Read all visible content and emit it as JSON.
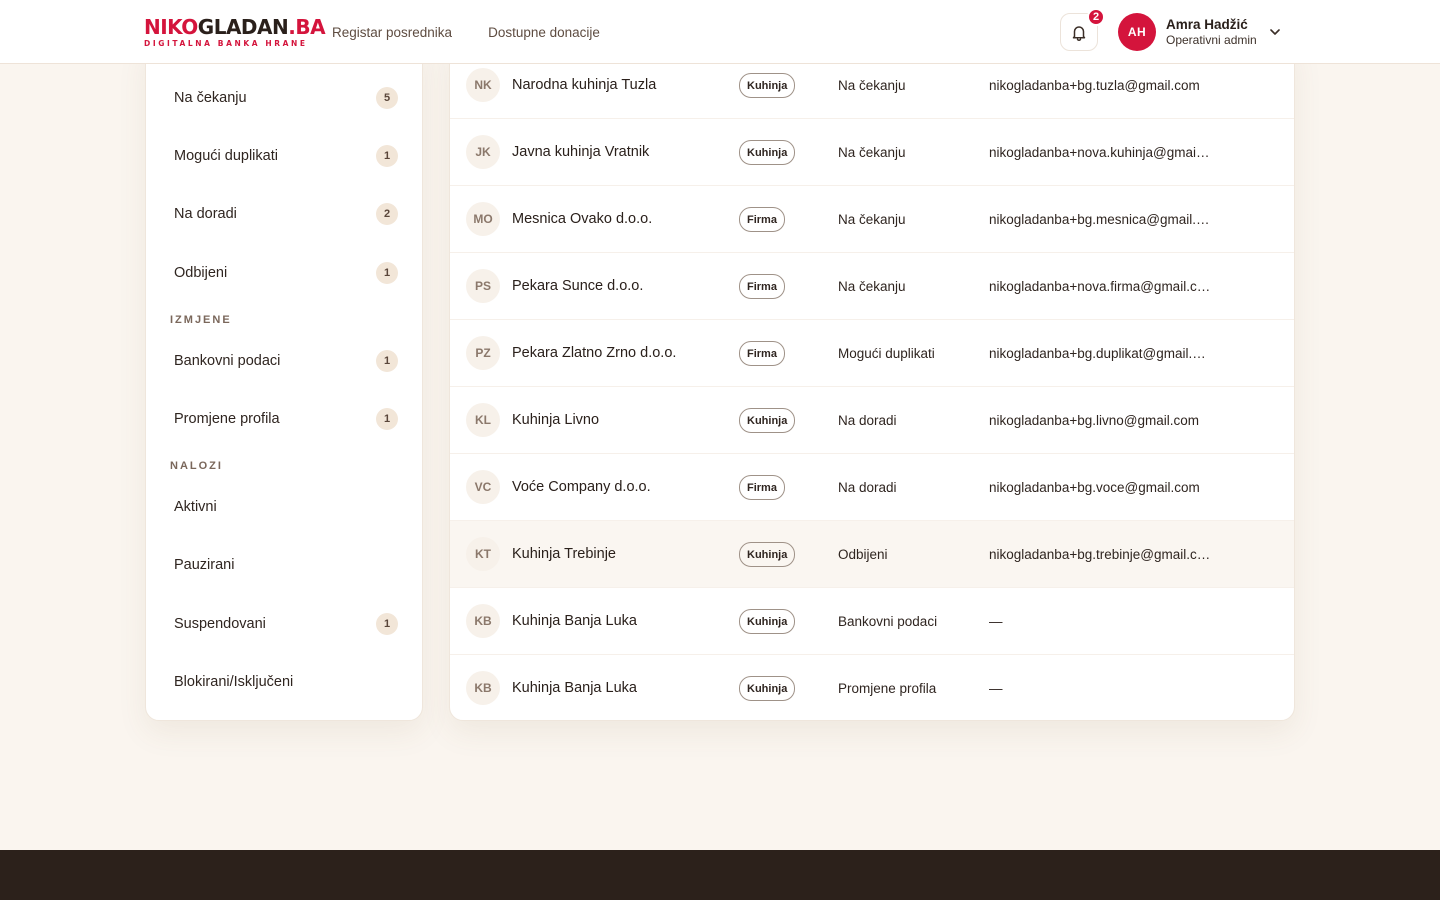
{
  "brand": {
    "logo_part1": "NIKO",
    "logo_part2": "GLADAN",
    "logo_part3": ".BA",
    "tagline": "DIGITALNA BANKA HRANE",
    "accent_color": "#d4143c"
  },
  "nav": {
    "registry": "Registar posrednika",
    "donations": "Dostupne donacije"
  },
  "notifications": {
    "icon": "bell-icon",
    "count": "2"
  },
  "user": {
    "initials": "AH",
    "name": "Amra Hadžić",
    "role": "Operativni admin",
    "menu_icon": "chevron-down-icon"
  },
  "sidebar": {
    "registration_items": [
      {
        "label": "Na čekanju",
        "count": "5"
      },
      {
        "label": "Mogući duplikati",
        "count": "1"
      },
      {
        "label": "Na doradi",
        "count": "2"
      },
      {
        "label": "Odbijeni",
        "count": "1"
      }
    ],
    "changes_heading": "IZMJENE",
    "changes_items": [
      {
        "label": "Bankovni podaci",
        "count": "1"
      },
      {
        "label": "Promjene profila",
        "count": "1"
      }
    ],
    "accounts_heading": "NALOZI",
    "accounts_items": [
      {
        "label": "Aktivni"
      },
      {
        "label": "Pauzirani"
      },
      {
        "label": "Suspendovani",
        "count": "1"
      },
      {
        "label": "Blokirani/Isključeni"
      }
    ]
  },
  "rows": [
    {
      "initials": "NK",
      "name": "Narodna kuhinja Tuzla",
      "type": "Kuhinja",
      "status": "Na čekanju",
      "email": "nikogladanba+bg.tuzla@gmail.com"
    },
    {
      "initials": "JK",
      "name": "Javna kuhinja Vratnik",
      "type": "Kuhinja",
      "status": "Na čekanju",
      "email": "nikogladanba+nova.kuhinja@gmail.com"
    },
    {
      "initials": "MO",
      "name": "Mesnica Ovako d.o.o.",
      "type": "Firma",
      "status": "Na čekanju",
      "email": "nikogladanba+bg.mesnica@gmail.com"
    },
    {
      "initials": "PS",
      "name": "Pekara Sunce d.o.o.",
      "type": "Firma",
      "status": "Na čekanju",
      "email": "nikogladanba+nova.firma@gmail.com"
    },
    {
      "initials": "PZ",
      "name": "Pekara Zlatno Zrno d.o.o.",
      "type": "Firma",
      "status": "Mogući duplikati",
      "email": "nikogladanba+bg.duplikat@gmail.com"
    },
    {
      "initials": "KL",
      "name": "Kuhinja Livno",
      "type": "Kuhinja",
      "status": "Na doradi",
      "email": "nikogladanba+bg.livno@gmail.com"
    },
    {
      "initials": "VC",
      "name": "Voće Company d.o.o.",
      "type": "Firma",
      "status": "Na doradi",
      "email": "nikogladanba+bg.voce@gmail.com"
    },
    {
      "initials": "KT",
      "name": "Kuhinja Trebinje",
      "type": "Kuhinja",
      "status": "Odbijeni",
      "email": "nikogladanba+bg.trebinje@gmail.com",
      "highlighted": true
    },
    {
      "initials": "KB",
      "name": "Kuhinja Banja Luka",
      "type": "Kuhinja",
      "status": "Bankovni podaci",
      "email": "—"
    },
    {
      "initials": "KB",
      "name": "Kuhinja Banja Luka",
      "type": "Kuhinja",
      "status": "Promjene profila",
      "email": "—"
    }
  ]
}
